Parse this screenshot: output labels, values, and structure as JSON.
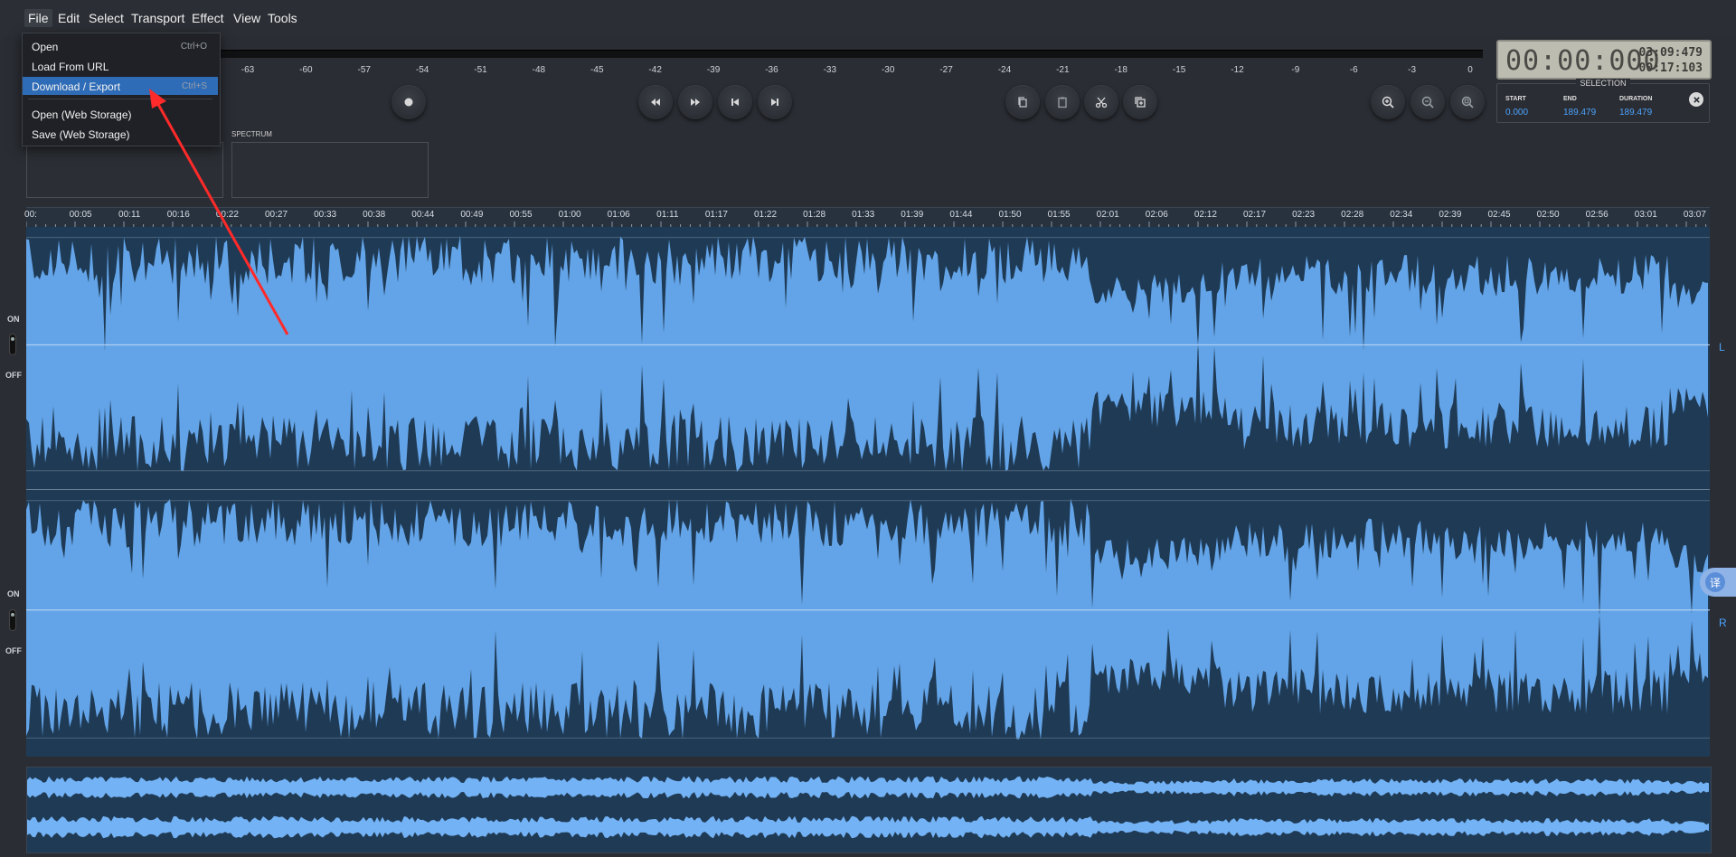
{
  "menu": {
    "items": [
      {
        "label": "File",
        "active": true
      },
      {
        "label": "Edit"
      },
      {
        "label": "Select"
      },
      {
        "label": "Transport"
      },
      {
        "label": "Effect"
      },
      {
        "label": "View"
      },
      {
        "label": "Tools"
      }
    ]
  },
  "file_menu": {
    "items": [
      {
        "label": "Open",
        "shortcut": "Ctrl+O"
      },
      {
        "label": "Load From URL",
        "shortcut": ""
      },
      {
        "label": "Download / Export",
        "shortcut": "Ctrl+S",
        "selected": true
      },
      {
        "label": "Open (Web Storage)",
        "shortcut": ""
      },
      {
        "label": "Save (Web Storage)",
        "shortcut": ""
      }
    ]
  },
  "meter": {
    "scale": [
      "-63",
      "-60",
      "-57",
      "-54",
      "-51",
      "-48",
      "-45",
      "-42",
      "-39",
      "-36",
      "-33",
      "-30",
      "-27",
      "-24",
      "-21",
      "-18",
      "-15",
      "-12",
      "-9",
      "-6",
      "-3",
      "0"
    ]
  },
  "transport": {
    "record_icon": "record-icon",
    "buttons": [
      "rewind-icon",
      "fast-forward-icon",
      "skip-to-start-icon",
      "skip-to-end-icon"
    ]
  },
  "edit_tools": [
    "copy-icon",
    "paste-icon",
    "cut-icon",
    "paste-mix-icon"
  ],
  "zoom_tools": [
    "zoom-in-icon",
    "zoom-out-icon",
    "zoom-fit-icon"
  ],
  "time_display": {
    "current": "00:00:000",
    "total": "03:09:479",
    "secondary": "00:17:103"
  },
  "selection": {
    "title": "SELECTION",
    "start_label": "START",
    "end_label": "END",
    "duration_label": "DURATION",
    "start": "0.000",
    "end": "189.479",
    "duration": "189.479"
  },
  "spectrum": {
    "label": "SPECTRUM"
  },
  "timeline": {
    "labels": [
      "00:",
      "00:05",
      "00:11",
      "00:16",
      "00:22",
      "00:27",
      "00:33",
      "00:38",
      "00:44",
      "00:49",
      "00:55",
      "01:00",
      "01:06",
      "01:11",
      "01:17",
      "01:22",
      "01:28",
      "01:33",
      "01:39",
      "01:44",
      "01:50",
      "01:55",
      "02:01",
      "02:06",
      "02:12",
      "02:17",
      "02:23",
      "02:28",
      "02:34",
      "02:39",
      "02:45",
      "02:50",
      "02:56",
      "03:01",
      "03:07"
    ]
  },
  "tracks": {
    "on_label": "ON",
    "off_label": "OFF",
    "left_label": "L",
    "right_label": "R"
  },
  "translate_badge": "译",
  "colors": {
    "waveform": "#63a4e8",
    "track_bg": "#1f3a54",
    "accent": "#4da3ff",
    "arrow": "#ff2a2a"
  }
}
